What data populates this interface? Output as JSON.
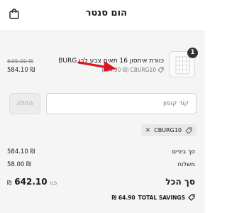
{
  "header": {
    "store_name": "הום סנטר"
  },
  "cart_item": {
    "quantity": "1",
    "name": "כוורת איחסון 16 תאים צבע לבן BURG",
    "discount_code": "CBURG10",
    "discount_amount": "(-64.90 ₪)",
    "original_price": "649.00 ₪",
    "final_price": "584.10 ₪"
  },
  "coupon": {
    "placeholder": "קוד קופון",
    "apply_label": "החלה",
    "applied_code": "CBURG10"
  },
  "summary": {
    "subtotal_label": "סך ביניים",
    "subtotal_value": "584.10 ₪",
    "shipping_label": "משלוח",
    "shipping_value": "58.00 ₪",
    "total_label": "סך הכל",
    "total_currency": "ILS",
    "total_symbol": "₪",
    "total_value": "642.10",
    "savings_label": "TOTAL SAVINGS",
    "savings_value": "₪ 64.90"
  },
  "colors": {
    "annotation_arrow": "#e0141e"
  },
  "icons": [
    "shopping-bag-icon",
    "tag-icon",
    "close-icon",
    "arrow-annotation"
  ]
}
